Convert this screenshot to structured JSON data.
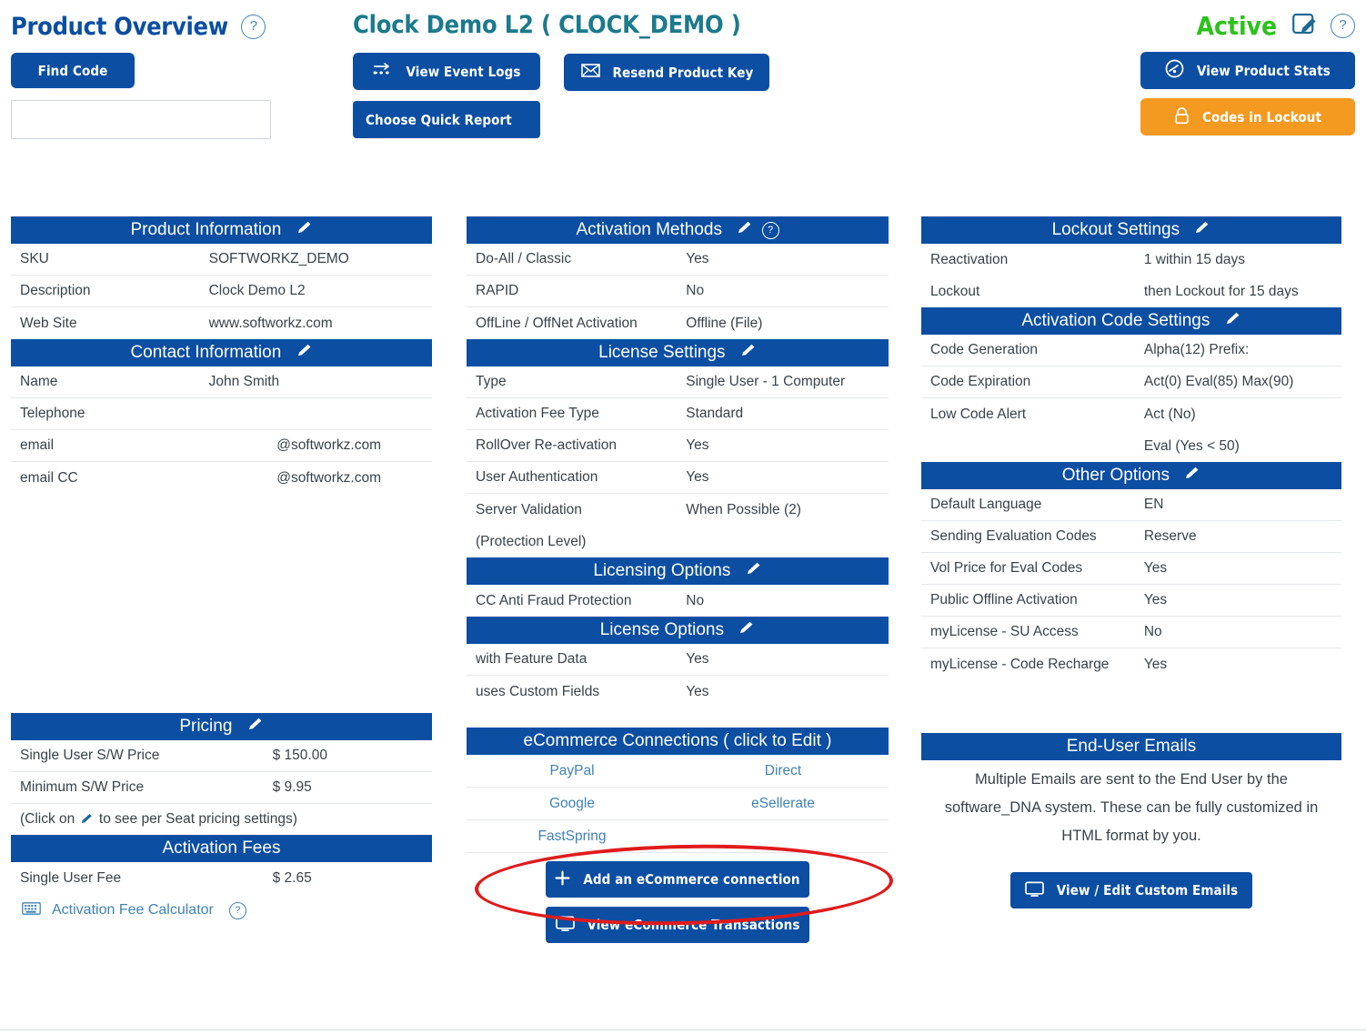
{
  "colors": {
    "brand_blue": "#0b4ea2",
    "accent_orange": "#f49a20",
    "status_green": "#2cc21a",
    "link_blue": "#3f82b4",
    "title_teal": "#1b7a8c",
    "annotation_red": "#e01b1b"
  },
  "header": {
    "page_title": "Product Overview",
    "help_label": "?",
    "find_code_button": "Find Code",
    "find_code_input_value": "",
    "find_code_input_placeholder": "",
    "product_title": "Clock Demo L2 ( CLOCK_DEMO )",
    "view_event_logs_button": "View Event Logs",
    "resend_product_key_button": "Resend Product Key",
    "choose_quick_report_button": "Choose Quick Report",
    "status": "Active",
    "view_product_stats_button": "View Product Stats",
    "codes_in_lockout_button": "Codes in Lockout"
  },
  "product_information": {
    "title": "Product Information",
    "rows": [
      {
        "label": "SKU",
        "value": "SOFTWORKZ_DEMO"
      },
      {
        "label": "Description",
        "value": "Clock Demo L2"
      },
      {
        "label": "Web Site",
        "value": "www.softworkz.com"
      }
    ]
  },
  "contact_information": {
    "title": "Contact Information",
    "rows": [
      {
        "label": "Name",
        "value": "John Smith"
      },
      {
        "label": "Telephone",
        "value": ""
      },
      {
        "label": "email",
        "value": "@softworkz.com"
      },
      {
        "label": "email CC",
        "value": "@softworkz.com"
      }
    ]
  },
  "pricing": {
    "title": "Pricing",
    "rows": [
      {
        "label": "Single User S/W Price",
        "value": "$ 150.00"
      },
      {
        "label": "Minimum S/W Price",
        "value": "$ 9.95"
      }
    ],
    "note_prefix": "(Click on",
    "note_suffix": "to see per Seat pricing settings)"
  },
  "activation_fees": {
    "title": "Activation Fees",
    "rows": [
      {
        "label": "Single User Fee",
        "value": "$ 2.65"
      }
    ],
    "calculator_link": "Activation Fee Calculator",
    "calculator_help": "?"
  },
  "activation_methods": {
    "title": "Activation Methods",
    "rows": [
      {
        "label": "Do-All / Classic",
        "value": "Yes"
      },
      {
        "label": "RAPID",
        "value": "No"
      },
      {
        "label": "OffLine / OffNet Activation",
        "value": "Offline (File)"
      }
    ]
  },
  "license_settings": {
    "title": "License Settings",
    "rows": [
      {
        "label": "Type",
        "value": "Single User - 1 Computer"
      },
      {
        "label": "Activation Fee Type",
        "value": "Standard"
      },
      {
        "label": "RollOver Re-activation",
        "value": "Yes"
      },
      {
        "label": "User Authentication",
        "value": "Yes"
      },
      {
        "label": "Server Validation",
        "value": "When Possible (2)"
      },
      {
        "label": "(Protection Level)",
        "value": ""
      }
    ]
  },
  "licensing_options": {
    "title": "Licensing Options",
    "rows": [
      {
        "label": "CC Anti Fraud Protection",
        "value": "No"
      }
    ]
  },
  "license_options": {
    "title": "License Options",
    "rows": [
      {
        "label": "with Feature Data",
        "value": "Yes"
      },
      {
        "label": "uses Custom Fields",
        "value": "Yes"
      }
    ]
  },
  "ecommerce": {
    "title": "eCommerce Connections ( click to Edit )",
    "rows": [
      {
        "left": "PayPal",
        "right": "Direct"
      },
      {
        "left": "Google",
        "right": "eSellerate"
      },
      {
        "left": "FastSpring",
        "right": ""
      }
    ],
    "add_button": "Add an eCommerce connection",
    "view_transactions_button": "View eCommerce Transactions"
  },
  "lockout_settings": {
    "title": "Lockout Settings",
    "rows": [
      {
        "label": "Reactivation",
        "value": "1 within 15 days"
      },
      {
        "label": "Lockout",
        "value": "then Lockout for 15 days"
      }
    ]
  },
  "activation_code_settings": {
    "title": "Activation Code Settings",
    "rows": [
      {
        "label": "Code Generation",
        "value": "Alpha(12)   Prefix:"
      },
      {
        "label": "Code Expiration",
        "value": "Act(0)   Eval(85)   Max(90)"
      },
      {
        "label": "Low Code Alert",
        "value": "Act   (No)"
      },
      {
        "label": "",
        "value": "Eval (Yes < 50)"
      }
    ]
  },
  "other_options": {
    "title": "Other Options",
    "rows": [
      {
        "label": "Default Language",
        "value": "EN"
      },
      {
        "label": "Sending Evaluation Codes",
        "value": "Reserve"
      },
      {
        "label": "Vol Price for Eval Codes",
        "value": "Yes"
      },
      {
        "label": "Public Offline Activation",
        "value": "Yes"
      },
      {
        "label": "myLicense - SU Access",
        "value": "No"
      },
      {
        "label": "myLicense - Code Recharge",
        "value": "Yes"
      }
    ]
  },
  "end_user_emails": {
    "title": "End-User Emails",
    "body_line_1": "Multiple Emails are sent to the End User by the",
    "body_line_2": "software_DNA system. These can be fully customized in",
    "body_line_3": "HTML format by you.",
    "button": "View / Edit Custom Emails"
  },
  "icons": {
    "help": "help-circle-icon",
    "pencil": "pencil-edit-icon",
    "edit_box": "edit-square-pencil-icon",
    "arrow_log": "arrow-log-icon",
    "envelope": "envelope-icon",
    "gauge": "gauge-stats-icon",
    "lock": "lock-icon",
    "plus": "plus-icon",
    "monitor": "monitor-screen-icon",
    "keyboard": "keyboard-calculator-icon"
  }
}
